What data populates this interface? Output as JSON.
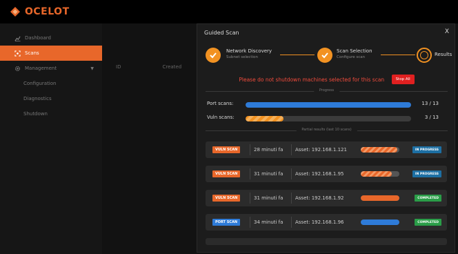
{
  "app": {
    "name": "OCELOT",
    "brand_color": "#e8672a"
  },
  "sidebar": {
    "items": [
      {
        "label": "Dashboard",
        "icon": "chart-icon",
        "active": false
      },
      {
        "label": "Scans",
        "icon": "scan-icon",
        "active": true
      },
      {
        "label": "Management",
        "icon": "gear-icon",
        "active": false,
        "expandable": true
      }
    ],
    "subitems": [
      {
        "label": "Configuration"
      },
      {
        "label": "Diagnostics"
      },
      {
        "label": "Shutdown"
      }
    ]
  },
  "background_table": {
    "columns": [
      "ID",
      "Created"
    ]
  },
  "modal": {
    "title": "Guided Scan",
    "close_label": "X",
    "steps": [
      {
        "label": "Network Discovery",
        "sublabel": "Subnet selection",
        "state": "done"
      },
      {
        "label": "Scan Selection",
        "sublabel": "Configure scan",
        "state": "done"
      },
      {
        "label": "Results",
        "sublabel": "",
        "state": "current"
      }
    ],
    "warning": "Please do not shutdown machines selected for this scan",
    "stop_all_label": "Stop All",
    "progress_heading": "Progress",
    "progress": [
      {
        "label": "Port scans:",
        "count": "13 / 13",
        "fraction": 1.0,
        "style": "blue"
      },
      {
        "label": "Vuln scans:",
        "count": "3 / 13",
        "fraction": 0.23,
        "style": "stripe"
      }
    ],
    "partial_heading": "Partial results (last 10 scans)",
    "results": [
      {
        "type": "VULN SCAN",
        "kind": "vuln",
        "time": "28 minuti fa",
        "asset": "Asset: 192.168.1.121",
        "fraction": 0.95,
        "bar": "stripe",
        "status": "IN PROGRESS",
        "status_kind": "inprog"
      },
      {
        "type": "VULN SCAN",
        "kind": "vuln",
        "time": "31 minuti fa",
        "asset": "Asset: 192.168.1.95",
        "fraction": 0.8,
        "bar": "stripe",
        "status": "IN PROGRESS",
        "status_kind": "inprog"
      },
      {
        "type": "VULN SCAN",
        "kind": "vuln",
        "time": "31 minuti fa",
        "asset": "Asset: 192.168.1.92",
        "fraction": 1.0,
        "bar": "orange",
        "status": "COMPLETED",
        "status_kind": "done"
      },
      {
        "type": "PORT SCAN",
        "kind": "port",
        "time": "34 minuti fa",
        "asset": "Asset: 192.168.1.96",
        "fraction": 1.0,
        "bar": "blue",
        "status": "COMPLETED",
        "status_kind": "done"
      }
    ]
  }
}
